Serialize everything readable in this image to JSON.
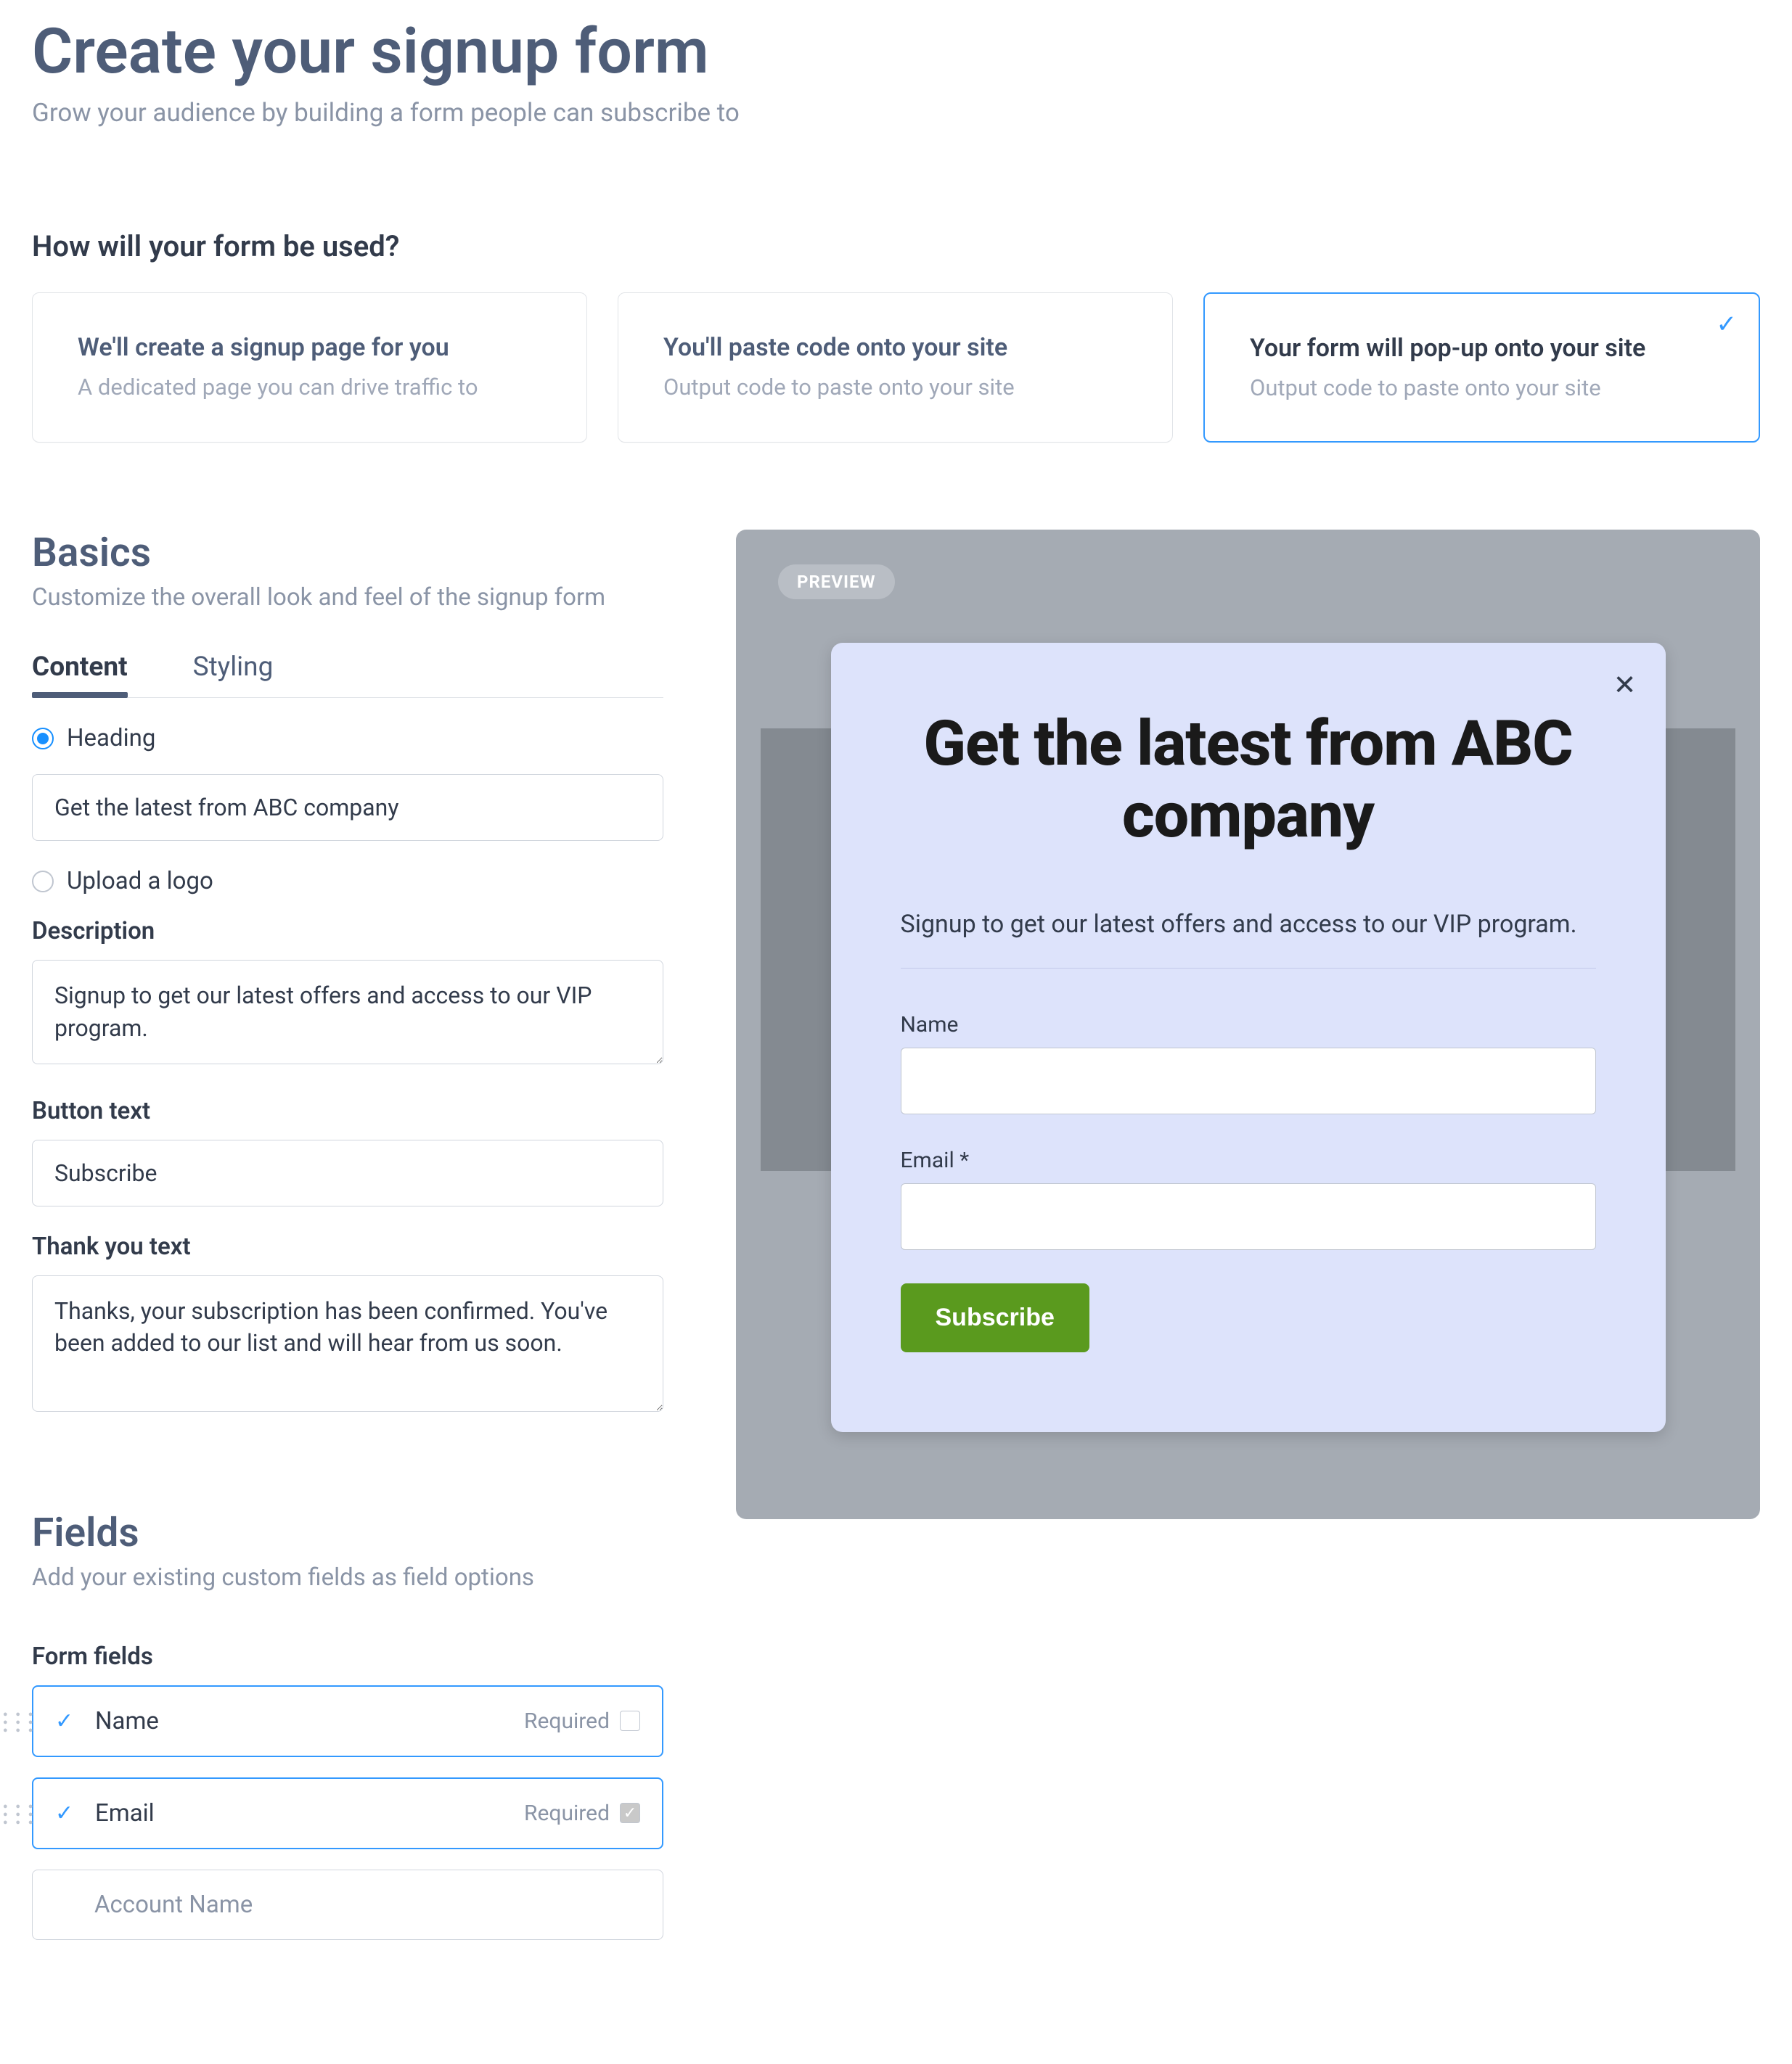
{
  "header": {
    "title": "Create your signup form",
    "subtitle": "Grow your audience by building a form people can subscribe to"
  },
  "usage": {
    "heading": "How will your form be used?",
    "cards": [
      {
        "title": "We'll create a signup page for you",
        "subtitle": "A dedicated page you can drive traffic to",
        "selected": false
      },
      {
        "title": "You'll paste code onto your site",
        "subtitle": "Output code to paste onto your site",
        "selected": false
      },
      {
        "title": "Your form will pop-up onto your site",
        "subtitle": "Output code to paste onto your site",
        "selected": true
      }
    ]
  },
  "basics": {
    "title": "Basics",
    "subtitle": "Customize the overall look and feel of the signup form",
    "tabs": {
      "content": "Content",
      "styling": "Styling",
      "active": "content"
    },
    "heading_option": "Heading",
    "heading_value": "Get the latest from ABC company",
    "upload_logo_option": "Upload a logo",
    "description_label": "Description",
    "description_value": "Signup to get our latest offers and access to our VIP program.",
    "button_text_label": "Button text",
    "button_text_value": "Subscribe",
    "thankyou_label": "Thank you text",
    "thankyou_value": "Thanks, your subscription has been confirmed. You've been added to our list and will hear from us soon."
  },
  "fields": {
    "title": "Fields",
    "subtitle": "Add your existing custom fields as field options",
    "form_fields_label": "Form fields",
    "required_label": "Required",
    "items": [
      {
        "name": "Name",
        "active": true,
        "required": false
      },
      {
        "name": "Email",
        "active": true,
        "required": true
      },
      {
        "name": "Account Name",
        "active": false,
        "required": null
      }
    ]
  },
  "preview": {
    "badge": "PREVIEW",
    "popup_heading": "Get the latest from ABC company",
    "popup_desc": "Signup to get our latest offers and access to our VIP program.",
    "name_label": "Name",
    "email_label": "Email *",
    "button": "Subscribe"
  }
}
